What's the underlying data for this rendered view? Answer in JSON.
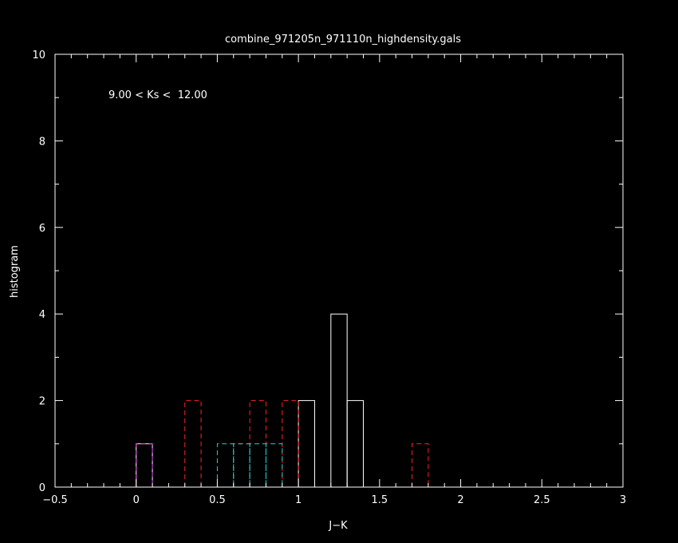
{
  "chart_data": {
    "type": "bar",
    "title": "combine_971205n_971110n_highdensity.gals",
    "xlabel": "J−K",
    "ylabel": "histogram",
    "annotation": "9.00 < Ks <  12.00",
    "xlim": [
      -0.5,
      3
    ],
    "ylim": [
      0,
      10
    ],
    "bin_width": 0.1,
    "x_ticks": [
      -0.5,
      0,
      0.5,
      1,
      1.5,
      2,
      2.5,
      3
    ],
    "x_tick_labels": [
      "−0.5",
      "0",
      "0.5",
      "1",
      "1.5",
      "2",
      "2.5",
      "3"
    ],
    "y_ticks": [
      0,
      2,
      4,
      6,
      8,
      10
    ],
    "y_tick_labels": [
      "0",
      "2",
      "4",
      "6",
      "8",
      "10"
    ],
    "grid": false,
    "series": [
      {
        "style": "solid",
        "color": "#ffffff",
        "bins": [
          {
            "x0": 0.0,
            "value": 1
          },
          {
            "x0": 1.0,
            "value": 2
          },
          {
            "x0": 1.2,
            "value": 4
          },
          {
            "x0": 1.3,
            "value": 2
          }
        ]
      },
      {
        "style": "dashed",
        "color": "#ff2020",
        "bins": [
          {
            "x0": 0.0,
            "value": 1
          },
          {
            "x0": 0.3,
            "value": 2
          },
          {
            "x0": 0.6,
            "value": 1
          },
          {
            "x0": 0.7,
            "value": 2
          },
          {
            "x0": 0.9,
            "value": 2
          },
          {
            "x0": 1.7,
            "value": 1
          }
        ]
      },
      {
        "style": "dashed",
        "color": "#20d0d0",
        "bins": [
          {
            "x0": 0.5,
            "value": 1
          },
          {
            "x0": 0.6,
            "value": 1
          },
          {
            "x0": 0.7,
            "value": 1
          },
          {
            "x0": 0.8,
            "value": 1
          }
        ]
      },
      {
        "style": "dashed",
        "color": "#c040ff",
        "bins": [
          {
            "x0": 0.0,
            "value": 1
          }
        ]
      }
    ]
  }
}
